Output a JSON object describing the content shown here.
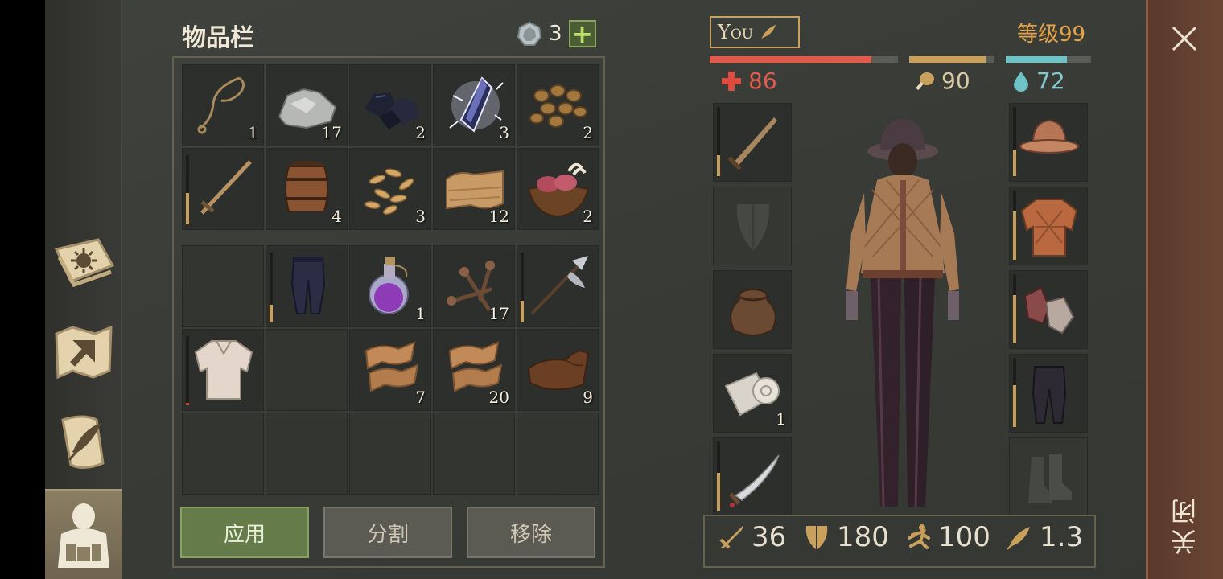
{
  "inventory": {
    "title": "物品栏",
    "gem_count": "3",
    "grid_top": [
      {
        "icon": "rope-icon",
        "qty": "1"
      },
      {
        "icon": "stone-icon",
        "qty": "17"
      },
      {
        "icon": "coal-icon",
        "qty": "2"
      },
      {
        "icon": "crystal-icon",
        "qty": "3"
      },
      {
        "icon": "nuts-icon",
        "qty": "2"
      },
      {
        "icon": "wooden-sword-icon",
        "qty": ""
      },
      {
        "icon": "barrel-icon",
        "qty": "4"
      },
      {
        "icon": "seeds-icon",
        "qty": "3"
      },
      {
        "icon": "cloth-icon",
        "qty": "12"
      },
      {
        "icon": "raw-meat-bowl-icon",
        "qty": "2"
      }
    ],
    "grid_bottom": [
      {
        "icon": "",
        "qty": ""
      },
      {
        "icon": "pants-icon",
        "qty": ""
      },
      {
        "icon": "potion-icon",
        "qty": "1"
      },
      {
        "icon": "nails-icon",
        "qty": "17"
      },
      {
        "icon": "halberd-icon",
        "qty": ""
      },
      {
        "icon": "shirt-icon",
        "qty": ""
      },
      {
        "icon": "",
        "qty": ""
      },
      {
        "icon": "hide-strips-icon",
        "qty": "7"
      },
      {
        "icon": "hide-strips-icon",
        "qty": "20"
      },
      {
        "icon": "leather-icon",
        "qty": "9"
      }
    ],
    "durability": {
      "wooden_sword": 0.45,
      "pants": 0.25,
      "halberd": 0.3,
      "shirt": 0.04
    }
  },
  "actions": {
    "apply": "应用",
    "split": "分割",
    "remove": "移除"
  },
  "character": {
    "name": "You",
    "level": "等级99",
    "health": "86",
    "food": "90",
    "water": "72",
    "health_fraction": 0.86,
    "food_fraction": 0.9,
    "water_fraction": 0.72,
    "bag_qty": "1"
  },
  "combat_stats": {
    "attack": "36",
    "defense": "180",
    "speed": "100",
    "weight": "1.3"
  },
  "close_label": "关闭",
  "colors": {
    "health": "#e05a4e",
    "food": "#c9a15d",
    "water": "#6fc2c6",
    "accent": "#e6a446"
  }
}
